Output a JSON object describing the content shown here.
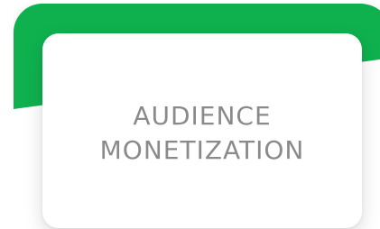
{
  "card": {
    "title_line1": "AUDIENCE",
    "title_line2": "MONETIZATION"
  },
  "colors": {
    "accent": "#0fb14f",
    "text": "#8a8a8a"
  }
}
